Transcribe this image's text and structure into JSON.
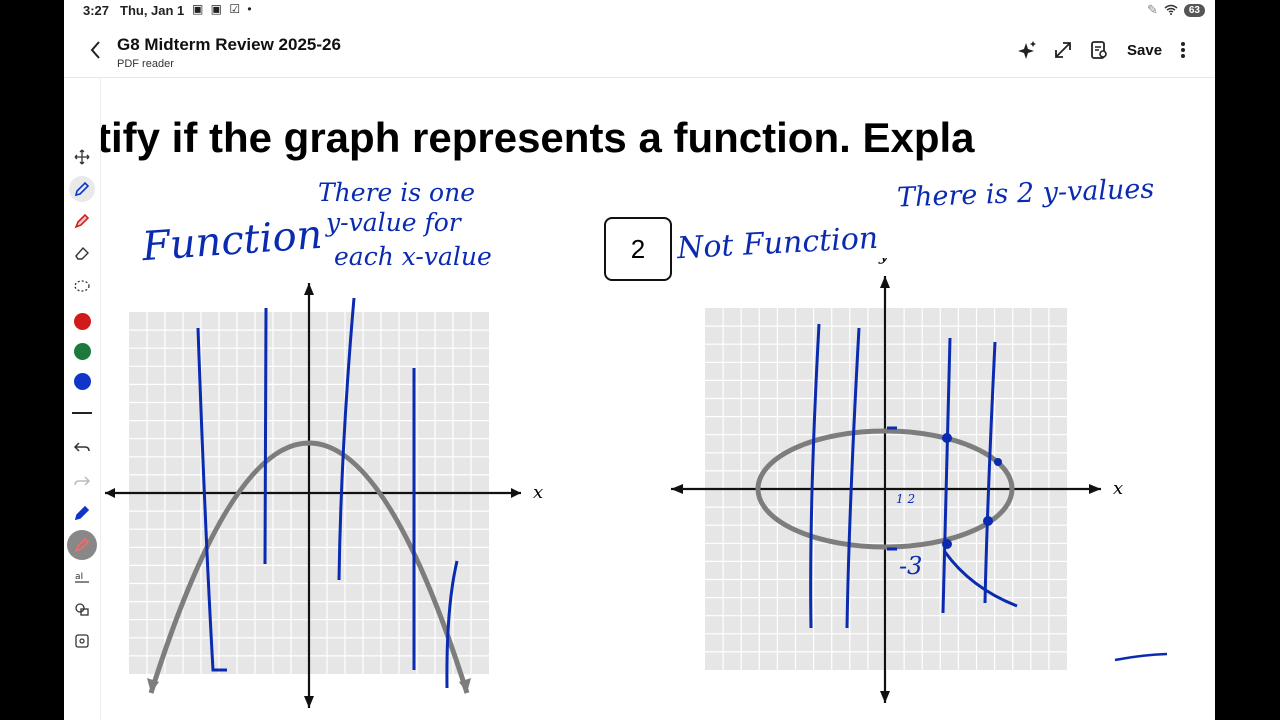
{
  "status": {
    "time": "3:27",
    "date": "Thu, Jan 1",
    "battery": "63"
  },
  "header": {
    "title": "G8 Midterm Review 2025-26",
    "subtitle": "PDF reader",
    "save_label": "Save"
  },
  "toolbar": {
    "icons": [
      "lasso-select-icon",
      "pen-icon",
      "highlighter-icon",
      "eraser-icon",
      "shape-select-icon",
      "undo-icon",
      "redo-icon",
      "pen-settings-icon",
      "laser-pointer-icon",
      "text-recognition-icon",
      "shapes-icon",
      "lock-icon"
    ],
    "colors": [
      "#d11a1a",
      "#1e7a3c",
      "#1036c8"
    ]
  },
  "document": {
    "heading": "entify if the graph represents a function. Expla",
    "problem_number": "2",
    "graph_axis_label_x": "x",
    "graph_axis_label_y": "y"
  },
  "annotations": {
    "left_answer": "Function",
    "left_note_line1": "There is one",
    "left_note_line2": "y-value for",
    "left_note_line3": "each x-value",
    "right_answer": "Not Function",
    "right_note": "There is 2 y-values",
    "right_mark": "-3",
    "right_ticks": "1 2"
  },
  "colors": {
    "ink": "#0a2bb0",
    "grid_bg": "#e6e6e6",
    "curve": "#7d7d7d"
  }
}
